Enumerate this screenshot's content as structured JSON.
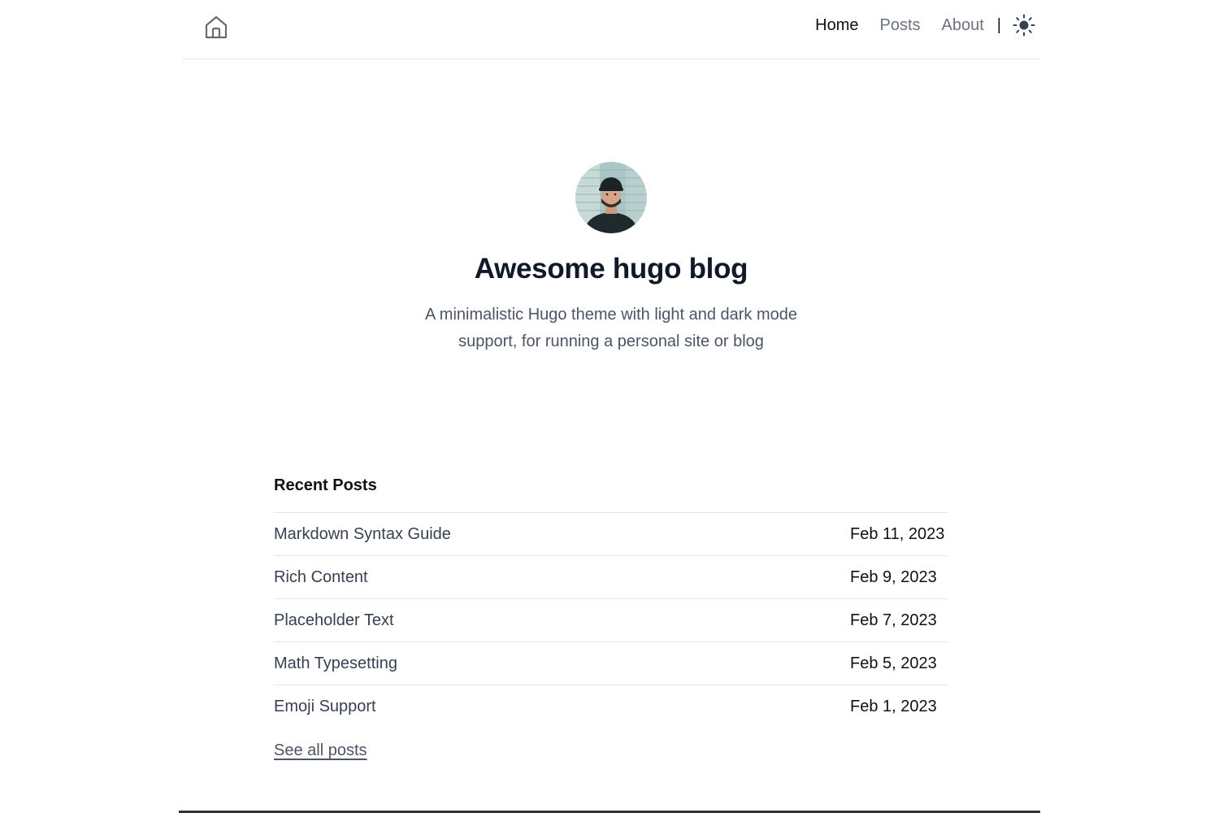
{
  "header": {
    "home_icon": "home-icon",
    "nav": [
      {
        "label": "Home",
        "active": true
      },
      {
        "label": "Posts",
        "active": false
      },
      {
        "label": "About",
        "active": false
      }
    ],
    "separator": "|",
    "theme_icon": "sun-icon"
  },
  "hero": {
    "avatar_icon": "avatar-photo",
    "title": "Awesome hugo blog",
    "description": "A minimalistic Hugo theme with light and dark mode support, for running a personal site or blog"
  },
  "recent": {
    "heading": "Recent Posts",
    "posts": [
      {
        "title": "Markdown Syntax Guide",
        "date": "Feb 11, 2023"
      },
      {
        "title": "Rich Content",
        "date": "Feb 9, 2023"
      },
      {
        "title": "Placeholder Text",
        "date": "Feb 7, 2023"
      },
      {
        "title": "Math Typesetting",
        "date": "Feb 5, 2023"
      },
      {
        "title": "Emoji Support",
        "date": "Feb 1, 2023"
      }
    ],
    "see_all": "See all posts"
  },
  "colors": {
    "text_primary": "#111111",
    "text_muted": "#6b7280",
    "divider": "#e5e7eb"
  }
}
